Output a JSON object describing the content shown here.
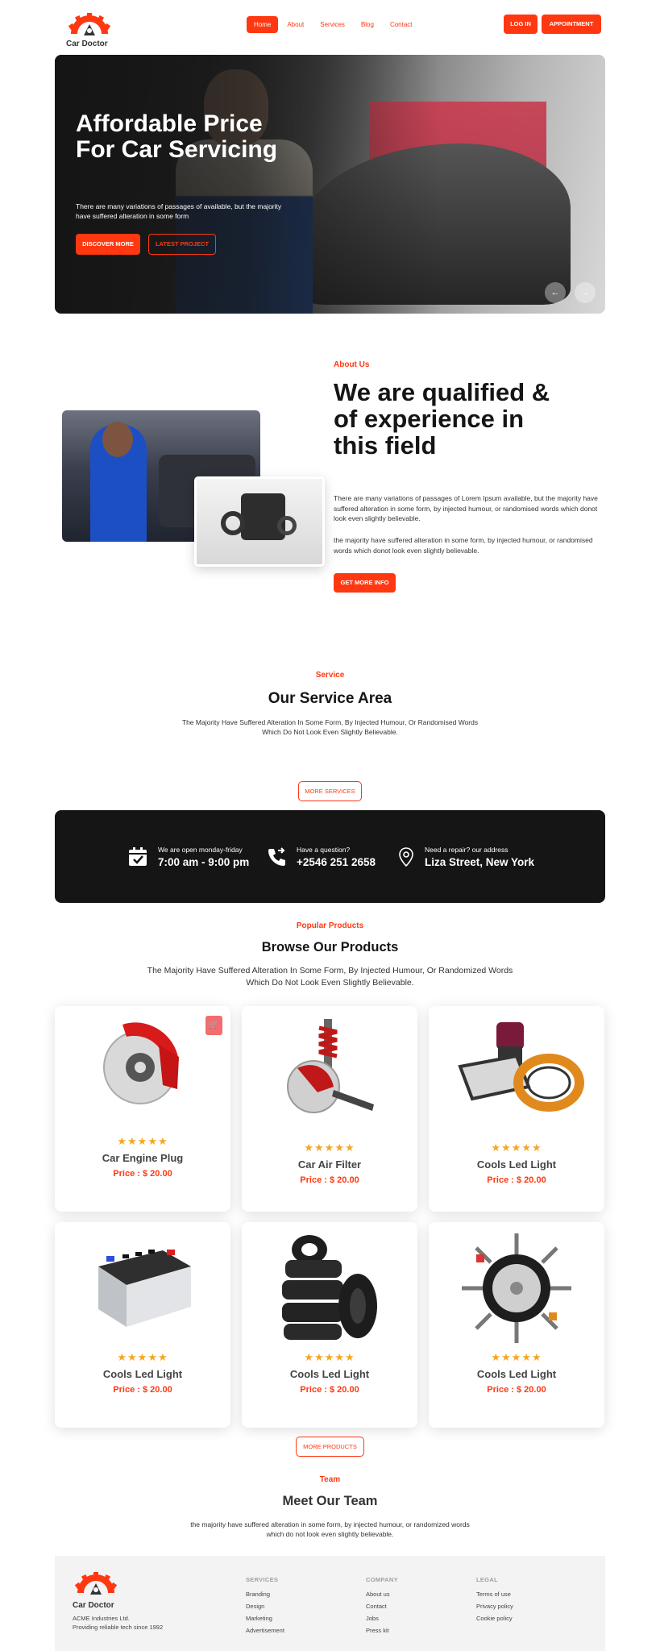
{
  "brand": {
    "name": "Car Doctor",
    "accent": "#ff3811",
    "dark": "#151515"
  },
  "nav": {
    "items": [
      {
        "label": "Home",
        "active": true
      },
      {
        "label": "About",
        "active": false
      },
      {
        "label": "Services",
        "active": false
      },
      {
        "label": "Blog",
        "active": false
      },
      {
        "label": "Contact",
        "active": false
      }
    ]
  },
  "header": {
    "login_label": "LOG IN",
    "appointment_label": "APPOINTMENT"
  },
  "hero": {
    "title": "Affordable Price For Car Servicing",
    "description": "There are many variations of passages of available, but the majority have suffered alteration in some form",
    "discover_label": "DISCOVER MORE",
    "latest_label": "LATEST PROJECT",
    "prev_icon": "arrow-left-icon",
    "next_icon": "arrow-right-icon"
  },
  "about": {
    "kicker": "About Us",
    "title": "We are qualified & of experience in this field",
    "paragraph1": "There are many variations of passages of Lorem Ipsum available, but the majority have suffered alteration in some form, by injected humour, or randomised words which donot look even slightly believable.",
    "paragraph2": "the majority have suffered alteration in some form, by injected humour, or randomised words which donot look even slightly believable.",
    "button_label": "GET MORE INFO"
  },
  "services": {
    "kicker": "Service",
    "title": "Our Service Area",
    "description": "The Majority Have Suffered Alteration In Some Form, By Injected Humour, Or Randomised Words Which Do Not Look Even Slightly Believable.",
    "more_label": "MORE SERVICES"
  },
  "info_bar": [
    {
      "icon": "calendar-check-icon",
      "label": "We are open monday-friday",
      "value": "7:00 am - 9:00 pm"
    },
    {
      "icon": "phone-icon",
      "label": "Have a question?",
      "value": "+2546 251 2658"
    },
    {
      "icon": "location-pin-icon",
      "label": "Need a repair? our address",
      "value": "Liza Street, New York"
    }
  ],
  "products": {
    "kicker": "Popular Products",
    "title": "Browse Our Products",
    "description": "The Majority Have Suffered Alteration In Some Form, By Injected Humour, Or Randomized Words Which Do Not Look Even Slightly Believable.",
    "rating_stars": 5,
    "items": [
      {
        "name": "Car Engine Plug",
        "price": "Price : $ 20.00",
        "image": "brake-disc"
      },
      {
        "name": "Car Air Filter",
        "price": "Price : $ 20.00",
        "image": "suspension"
      },
      {
        "name": "Cools Led Light",
        "price": "Price : $ 20.00",
        "image": "air-filters"
      },
      {
        "name": "Cools Led Light",
        "price": "Price : $ 20.00",
        "image": "battery"
      },
      {
        "name": "Cools Led Light",
        "price": "Price : $ 20.00",
        "image": "tires"
      },
      {
        "name": "Cools Led Light",
        "price": "Price : $ 20.00",
        "image": "wheel-parts"
      }
    ],
    "more_label": "MORE PRODUCTS"
  },
  "team": {
    "kicker": "Team",
    "title": "Meet Our Team",
    "description": "the majority have suffered alteration in some form, by injected humour, or randomized words which do not look even slightly believable."
  },
  "footer": {
    "company_line1": "ACME Industries Ltd.",
    "company_line2": "Providing reliable tech since 1992",
    "columns": [
      {
        "title": "SERVICES",
        "links": [
          "Branding",
          "Design",
          "Marketing",
          "Advertisement"
        ]
      },
      {
        "title": "COMPANY",
        "links": [
          "About us",
          "Contact",
          "Jobs",
          "Press kit"
        ]
      },
      {
        "title": "LEGAL",
        "links": [
          "Terms of use",
          "Privacy policy",
          "Cookie policy"
        ]
      }
    ]
  }
}
